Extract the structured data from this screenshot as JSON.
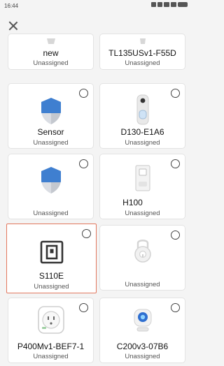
{
  "status_bar": {
    "time": "16:44"
  },
  "devices": [
    {
      "name": "new",
      "status": "Unassigned",
      "icon": "device-icon"
    },
    {
      "name": "TL135USv1-F55D",
      "status": "Unassigned",
      "icon": "device-icon"
    },
    {
      "name": "Sensor",
      "status": "Unassigned",
      "icon": "shield-icon"
    },
    {
      "name": "D130-E1A6",
      "status": "Unassigned",
      "icon": "doorbell-icon"
    },
    {
      "name": "",
      "status": "Unassigned",
      "icon": "shield-icon"
    },
    {
      "name": "H100",
      "status": "Unassigned",
      "icon": "hub-icon"
    },
    {
      "name": "S110E",
      "status": "Unassigned",
      "icon": "switch-icon",
      "selected": true
    },
    {
      "name": "",
      "status": "Unassigned",
      "icon": "lock-icon"
    },
    {
      "name": "P400Mv1-BEF7-1",
      "status": "Unassigned",
      "icon": "plug-icon"
    },
    {
      "name": "C200v3-07B6",
      "status": "Unassigned",
      "icon": "camera-icon"
    }
  ],
  "colors": {
    "accent_selected": "#e2775e",
    "shield_blue": "#3f7fd0"
  }
}
